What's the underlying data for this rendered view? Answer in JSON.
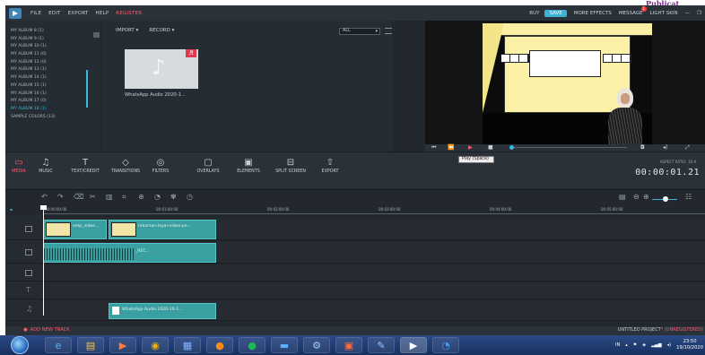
{
  "corner_text": "Publicat",
  "menu": {
    "items": [
      "FILE",
      "EDIT",
      "EXPORT",
      "HELP"
    ],
    "register": "REGISTER",
    "right": {
      "buy": "BUY",
      "save": "SAVE",
      "more_effects": "MORE EFFECTS",
      "messages": "MESSAGE",
      "message_count": "1",
      "skin": "LIGHT SKIN"
    }
  },
  "albums": {
    "items": [
      "MY ALBUM 8 (1)",
      "MY ALBUM 9 (1)",
      "MY ALBUM 10 (1)",
      "MY ALBUM 11 (0)",
      "MY ALBUM 12 (0)",
      "MY ALBUM 13 (1)",
      "MY ALBUM 14 (1)",
      "MY ALBUM 15 (1)",
      "MY ALBUM 16 (1)",
      "MY ALBUM 17 (0)",
      "MY ALBUM 18 (1)",
      "SAMPLE COLORS (13)"
    ],
    "selected_index": 10
  },
  "library": {
    "import_label": "IMPORT ▾",
    "record_label": "RECORD ▾",
    "filter_value": "ALL",
    "media_item_label": "WhatsApp Audio 2020-1..."
  },
  "tabs": [
    {
      "label": "MEDIA",
      "icon": "folder-icon",
      "active": true
    },
    {
      "label": "MUSIC",
      "icon": "music-icon",
      "active": false
    },
    {
      "label": "TEXT/CREDIT",
      "icon": "text-icon",
      "active": false
    },
    {
      "label": "TRANSITIONS",
      "icon": "transitions-icon",
      "active": false
    },
    {
      "label": "FILTERS",
      "icon": "filters-icon",
      "active": false
    },
    {
      "label": "OVERLAYS",
      "icon": "overlays-icon",
      "active": false
    },
    {
      "label": "ELEMENTS",
      "icon": "elements-icon",
      "active": false
    },
    {
      "label": "SPLIT SCREEN",
      "icon": "split-screen-icon",
      "active": false
    },
    {
      "label": "EXPORT",
      "icon": "export-icon",
      "active": false
    }
  ],
  "tooltip": "Play (Space)",
  "aspect_ratio": "ASPECT RATIO: 16:9",
  "timecode": "00:00:01.21",
  "ruler": {
    "ticks": [
      "00:00:00:00",
      "00:01:00:00",
      "00:02:00:00",
      "00:03:00:00",
      "00:04:00:00",
      "00:05:00:00"
    ]
  },
  "clips": {
    "video_label_short": "emp_video...",
    "video_label_long": "rekaman-layar-video-pe...",
    "audio_clip_label": "_REC...",
    "music_clip_label": "WhatsApp Audio 2020-10-1..."
  },
  "footer": {
    "add_track": "ADD NEW TRACK",
    "project": "UNTITLED PROJECT",
    "unregistered": "* (UNREGISTERED)"
  },
  "taskbar": {
    "language": "IN",
    "time": "23:50",
    "date": "19/10/2020"
  }
}
